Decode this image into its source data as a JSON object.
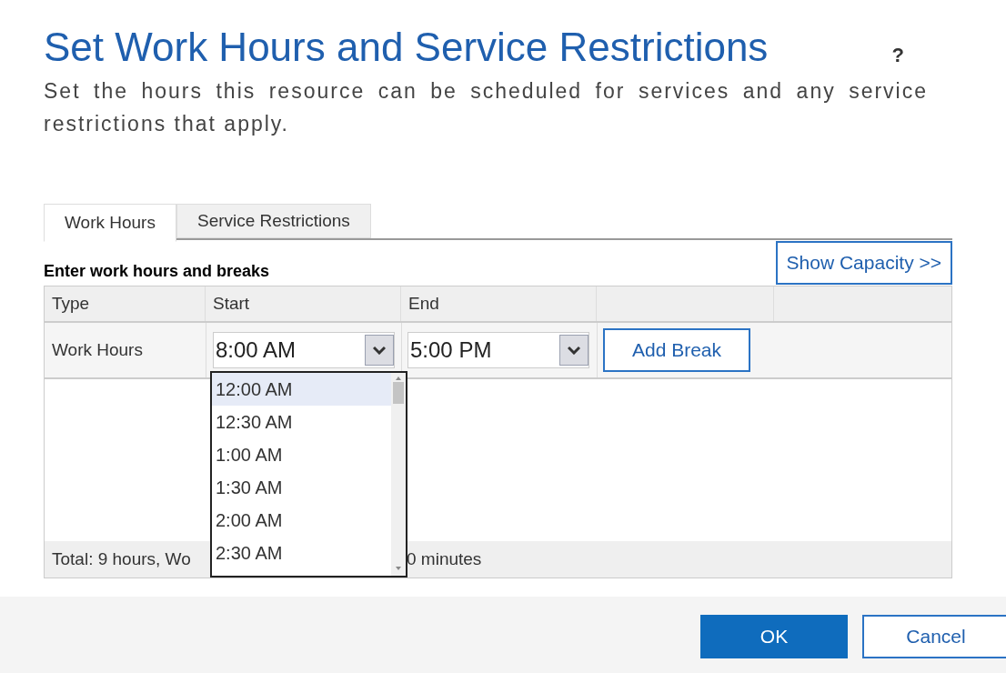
{
  "title": "Set Work Hours and Service Restrictions",
  "help": "?",
  "description": "Set the hours this resource can be scheduled for services and any service restrictions that apply.",
  "tabs": [
    {
      "label": "Work Hours",
      "selected": true
    },
    {
      "label": "Service Restrictions",
      "selected": false
    }
  ],
  "show_capacity": "Show Capacity >>",
  "section_title": "Enter work hours and breaks",
  "table": {
    "columns": [
      "Type",
      "Start",
      "End"
    ],
    "rows": [
      {
        "type": "Work Hours",
        "start": "8:00 AM",
        "end": "5:00 PM",
        "action": "Add Break"
      }
    ],
    "footer": [
      "Total: 9 hours, Wo",
      "0 minutes"
    ]
  },
  "dropdown": {
    "options": [
      {
        "label": "12:00 AM",
        "selected": true
      },
      {
        "label": "12:30 AM",
        "selected": false
      },
      {
        "label": "1:00 AM",
        "selected": false
      },
      {
        "label": "1:30 AM",
        "selected": false
      },
      {
        "label": "2:00 AM",
        "selected": false
      },
      {
        "label": "2:30 AM",
        "selected": false
      }
    ]
  },
  "buttons": [
    {
      "label": "OK",
      "kind": "primary"
    },
    {
      "label": "Cancel",
      "kind": "secondary"
    }
  ]
}
